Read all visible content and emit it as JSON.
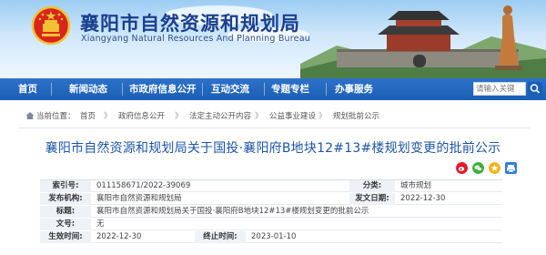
{
  "header": {
    "title": "襄阳市自然资源和规划局",
    "subtitle": "Xiangyang Natural Resources And Planning Bureau"
  },
  "nav": {
    "items": [
      "首页",
      "新闻动态",
      "市政府信息公开",
      "互动交流",
      "专题专栏",
      "办事服务"
    ],
    "search_placeholder": "请输入关键"
  },
  "breadcrumb": {
    "prefix": "当前位置：",
    "items": [
      "首页",
      "政府信息公开",
      "法定主动公开内容",
      "公益事业建设",
      "规划批前公示"
    ],
    "separator": "》"
  },
  "article": {
    "title": "襄阳市自然资源和规划局关于国投·襄阳府B地块12#13#楼规划变更的批前公示"
  },
  "share": {
    "icons": [
      "weibo-icon",
      "wechat-icon",
      "qzone-icon",
      "print-icon"
    ]
  },
  "info": {
    "index_label": "索引号:",
    "index_value": "011158671/2022-39069",
    "category_label": "分类:",
    "category_value": "城市规划",
    "publisher_label": "发布机构:",
    "publisher_value": "襄阳市自然资源和规划局",
    "date_label": "发文日期:",
    "date_value": "2022-12-30",
    "title_label": "标题:",
    "title_value": "襄阳市自然资源和规划局关于国投·襄阳府B地块12#13#楼规划变更的批前公示",
    "docno_label": "文号:",
    "docno_value": "无",
    "effective_label": "生效时间:",
    "effective_value": "2022-12-30",
    "expiry_label": "终止时间:",
    "expiry_value": "2023-01-10"
  },
  "colors": {
    "nav_blue": "#1b5eb5",
    "title_blue": "#1c56a8",
    "header_text": "#1b3f8f"
  }
}
